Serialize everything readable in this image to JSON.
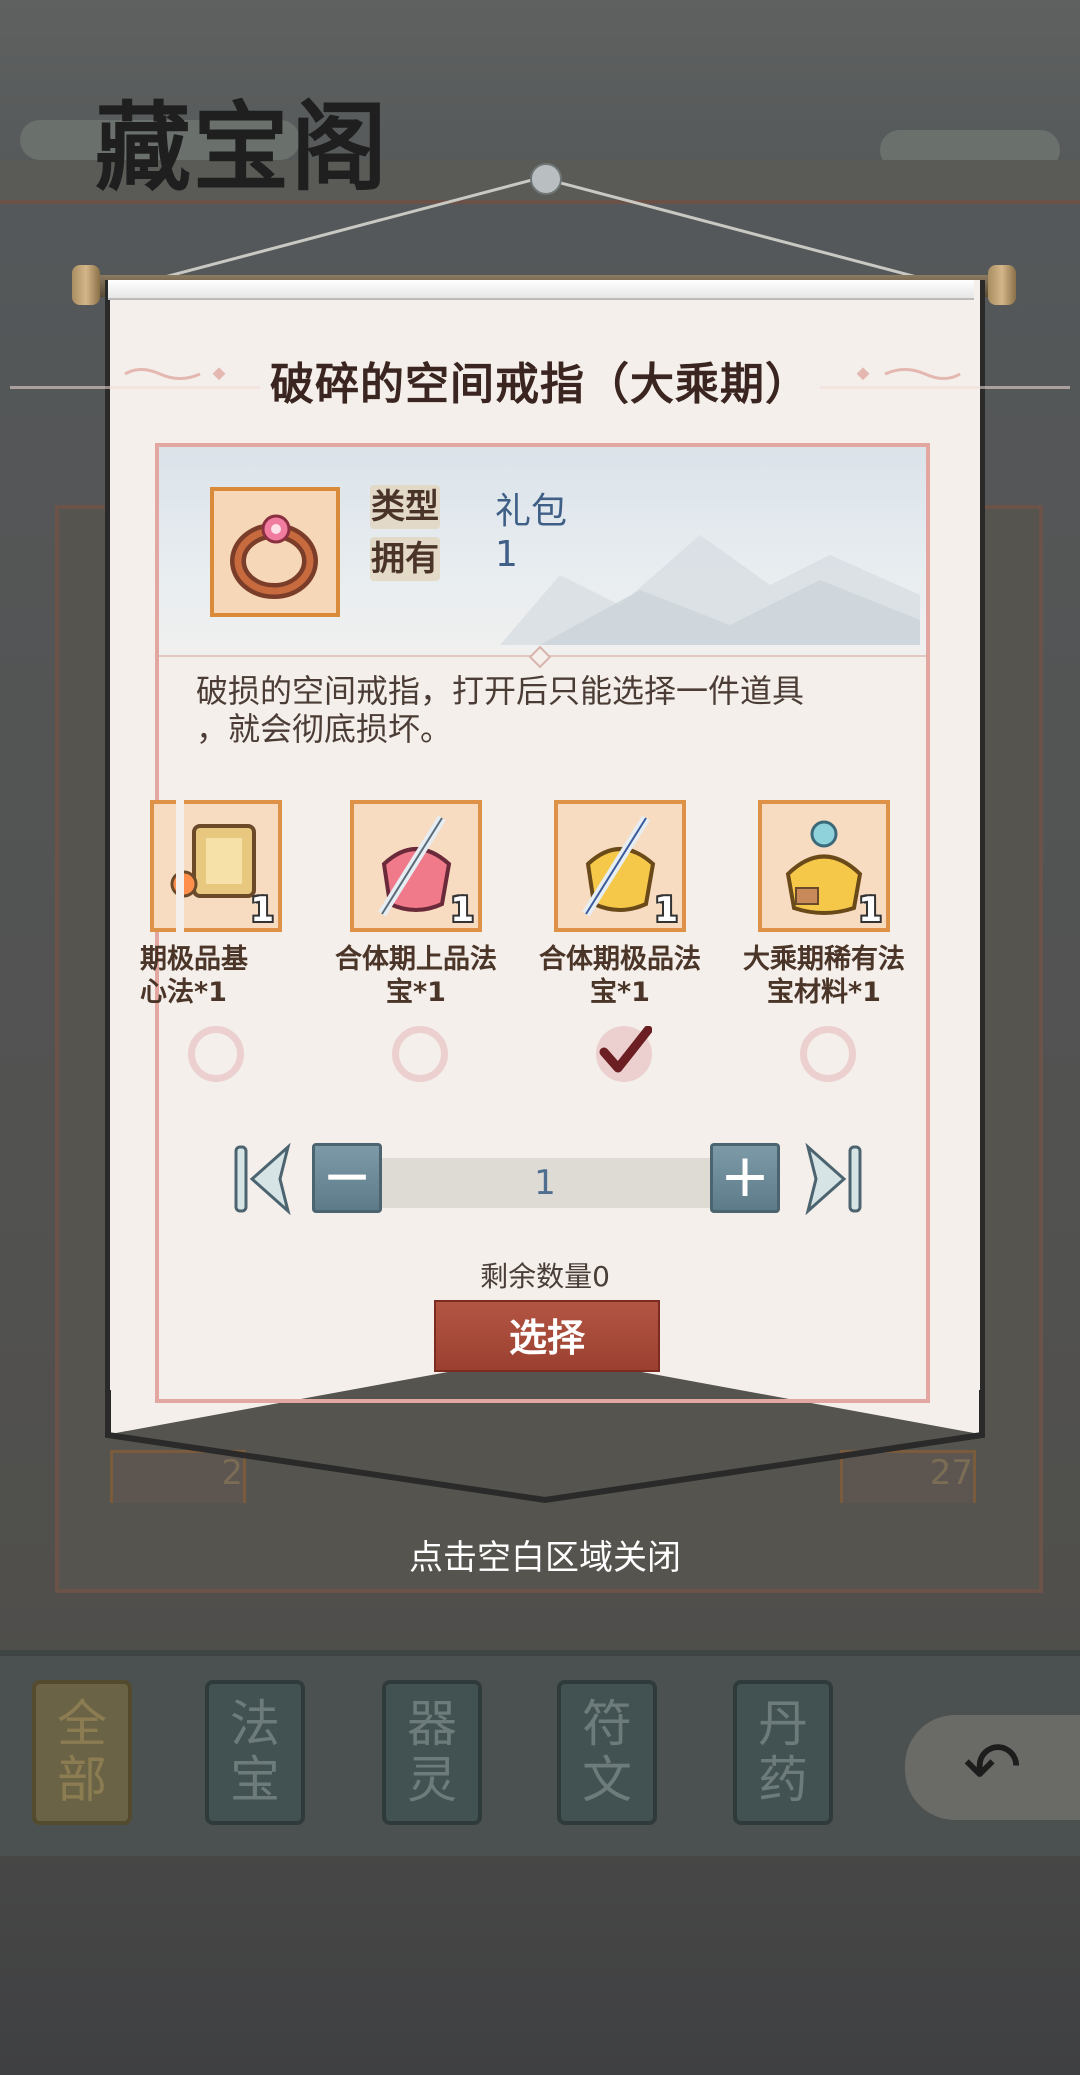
{
  "background": {
    "title": "藏宝阁",
    "slot_counts": [
      "2",
      "27"
    ],
    "tabs": [
      {
        "label": "全部",
        "active": true
      },
      {
        "label": "法宝",
        "active": false
      },
      {
        "label": "器灵",
        "active": false
      },
      {
        "label": "符文",
        "active": false
      },
      {
        "label": "丹药",
        "active": false
      }
    ],
    "back_icon": "back-arrow-icon"
  },
  "dialog": {
    "title": "破碎的空间戒指（大乘期）",
    "type_label": "类型",
    "type_value": "礼包",
    "own_label": "拥有",
    "own_value": "1",
    "item_icon": "ring-icon",
    "description_line1": "破损的空间戒指，打开后只能选择一件道具",
    "description_line2": "，就会彻底损坏。",
    "rewards": [
      {
        "icon": "scroll-bundle-icon",
        "count": "1",
        "line1": "期极品基",
        "line2": "心法*1",
        "selected": false
      },
      {
        "icon": "sword-pouch-red-icon",
        "count": "1",
        "line1": "合体期上品法",
        "line2": "宝*1",
        "selected": false
      },
      {
        "icon": "sword-pouch-gold-icon",
        "count": "1",
        "line1": "合体期极品法",
        "line2": "宝*1",
        "selected": true
      },
      {
        "icon": "material-pouch-icon",
        "count": "1",
        "line1": "大乘期稀有法",
        "line2": "宝材料*1",
        "selected": false
      }
    ],
    "quantity": "1",
    "remaining": "剩余数量0",
    "select_label": "选择"
  },
  "close_hint": "点击空白区域关闭",
  "colors": {
    "scroll": "#f4efea",
    "accent_border": "#e2a7a0",
    "select_button": "#a84a39",
    "stepper_button": "#6b8996",
    "value_text": "#3f5f86"
  }
}
